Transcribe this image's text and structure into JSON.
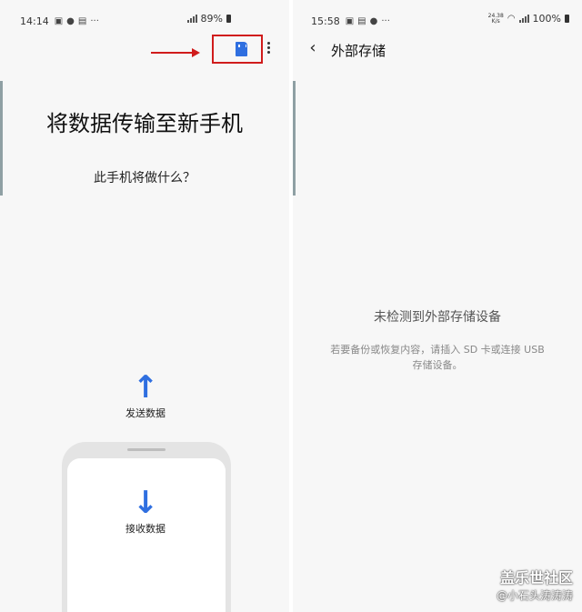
{
  "left": {
    "status": {
      "time": "14:14",
      "battery": "89%"
    },
    "title": "将数据传输至新手机",
    "subtitle": "此手机将做什么？",
    "send_label": "发送数据",
    "receive_label": "接收数据",
    "icons": {
      "sd": "sd-card-icon",
      "more": "more-vert-icon",
      "up": "arrow-up-icon",
      "down": "arrow-down-icon"
    }
  },
  "right": {
    "status": {
      "time": "15:58",
      "speed_value": "24.38",
      "speed_unit": "K/s",
      "battery": "100%"
    },
    "header_title": "外部存储",
    "empty_title": "未检测到外部存储设备",
    "empty_desc": "若要备份或恢复内容，请插入 SD 卡或连接 USB 存储设备。"
  },
  "watermark": {
    "line1": "盖乐世社区",
    "line2": "@小石头涛涛涛"
  },
  "colors": {
    "accent": "#2f6fe0",
    "annotation": "#d01c1c",
    "background": "#f7f7f7"
  }
}
